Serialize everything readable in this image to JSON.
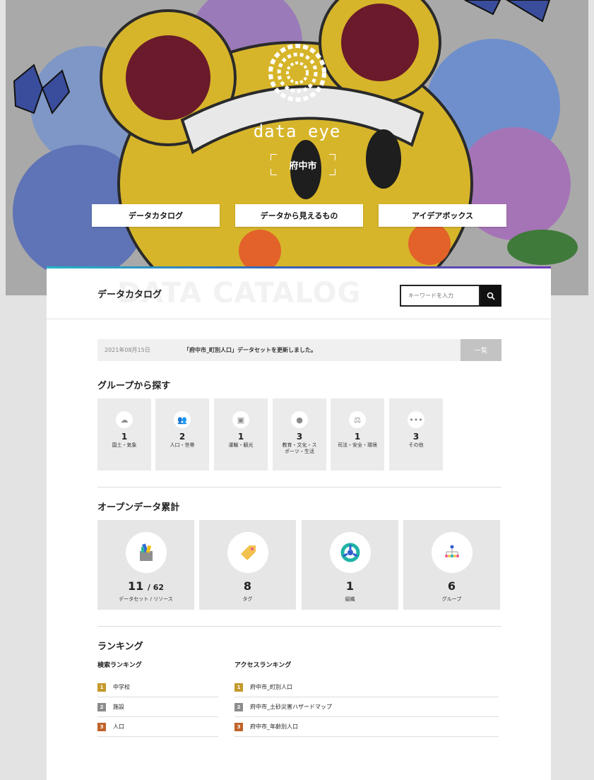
{
  "brand": {
    "name": "data eye",
    "city": "府中市"
  },
  "nav": [
    {
      "label": "データカタログ"
    },
    {
      "label": "データから見えるもの"
    },
    {
      "label": "アイデアボックス"
    }
  ],
  "panel": {
    "title": "データカタログ",
    "ghost": "DATA CATALOG"
  },
  "search": {
    "placeholder": "キーワードを入力",
    "icon": "search-icon"
  },
  "news": {
    "date": "2021年08月15日",
    "text": "「府中市_町別人口」データセットを更新しました。",
    "button": "一覧"
  },
  "groups": {
    "title": "グループから探す",
    "items": [
      {
        "count": "1",
        "label": "国土・気象",
        "icon": "cloud-icon"
      },
      {
        "count": "2",
        "label": "人口・世帯",
        "icon": "people-icon"
      },
      {
        "count": "1",
        "label": "運輸・観光",
        "icon": "bus-icon"
      },
      {
        "count": "3",
        "label": "教育・文化・ス\nポーツ・生活",
        "icon": "globe-icon"
      },
      {
        "count": "1",
        "label": "司法・安全・環境",
        "icon": "scales-icon"
      },
      {
        "count": "3",
        "label": "その他",
        "icon": "more-icon"
      }
    ]
  },
  "stats": {
    "title": "オープンデータ累計",
    "items": [
      {
        "value": "11",
        "sub": "/ 62",
        "label": "データセット / リソース",
        "icon": "box-icon"
      },
      {
        "value": "8",
        "sub": "",
        "label": "タグ",
        "icon": "tag-icon"
      },
      {
        "value": "1",
        "sub": "",
        "label": "組織",
        "icon": "organization-icon"
      },
      {
        "value": "6",
        "sub": "",
        "label": "グループ",
        "icon": "group-tree-icon"
      }
    ]
  },
  "ranking": {
    "title": "ランキング",
    "search": {
      "title": "検索ランキング",
      "items": [
        {
          "rank": "1",
          "label": "中学校"
        },
        {
          "rank": "2",
          "label": "施設"
        },
        {
          "rank": "3",
          "label": "人口"
        }
      ]
    },
    "access": {
      "title": "アクセスランキング",
      "items": [
        {
          "rank": "1",
          "label": "府中市_町別人口"
        },
        {
          "rank": "2",
          "label": "府中市_土砂災害ハザードマップ"
        },
        {
          "rank": "3",
          "label": "府中市_年齢別人口"
        }
      ]
    }
  },
  "colors": {
    "gold": "#c49a2c",
    "silver": "#8c8c8c",
    "bronze": "#c0632a",
    "accent_start": "#23b5c9",
    "accent_end": "#6c3db7"
  }
}
